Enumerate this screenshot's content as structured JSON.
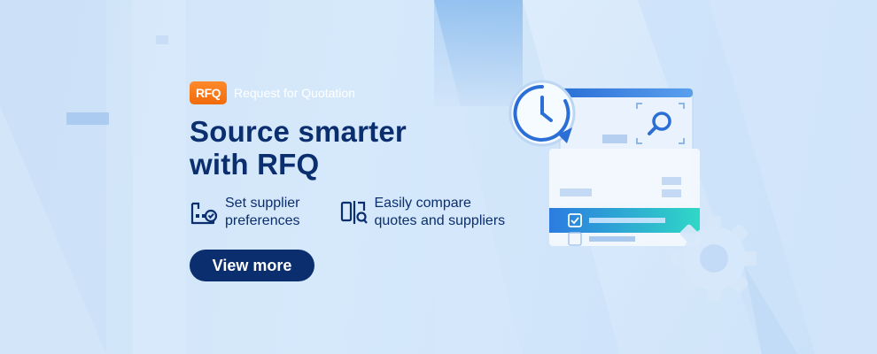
{
  "brand": {
    "logo_text": "RFQ",
    "label": "Request for Quotation"
  },
  "headline": {
    "line1": "Source smarter",
    "line2": "with RFQ"
  },
  "features": [
    {
      "icon": "supplier-preferences-icon",
      "line1": "Set supplier",
      "line2": "preferences"
    },
    {
      "icon": "compare-quotes-icon",
      "line1": "Easily compare",
      "line2": "quotes and suppliers"
    }
  ],
  "cta": {
    "label": "View more"
  },
  "colors": {
    "navy": "#0b2e6f",
    "brand_orange": "#f26a0a",
    "card_blue": "#2b6fd6",
    "teal": "#27d3c2"
  }
}
